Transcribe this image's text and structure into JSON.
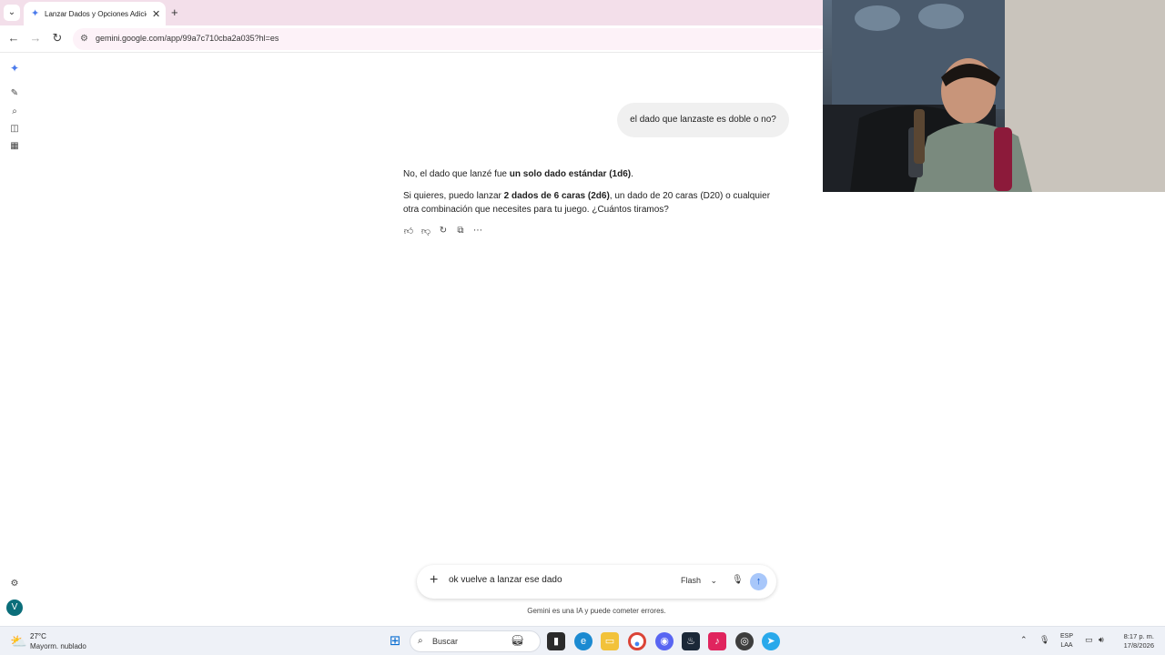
{
  "browser": {
    "tab_list_icon": "chevron-down-icon",
    "tab_title": "Lanzar Dados y Opciones Adicio",
    "tab_close": "✕",
    "new_tab": "+",
    "url": "gemini.google.com/app/99a7c710cba2a035?hl=es"
  },
  "conversation": {
    "user_message": "el dado que lanzaste es doble o no?",
    "response_p1_a": "No, el dado que lanzé fue ",
    "response_p1_b": "un solo dado estándar (1d6)",
    "response_p1_c": ".",
    "response_p2_a": "Si quieres, puedo lanzar ",
    "response_p2_b": "2 dados de 6 caras (2d6)",
    "response_p2_c": ", un dado de 20 caras (D20) o cualquier otra combinación que necesites para tu juego. ¿Cuántos tiramos?",
    "actions": [
      "thumb-up-icon",
      "thumb-down-icon",
      "regenerate-icon",
      "copy-icon",
      "more-icon"
    ]
  },
  "composer": {
    "input_value": "ok vuelve a lanzar ese dado",
    "model": "Flash",
    "disclaimer": "Gemini es una IA y puede cometer errores."
  },
  "sidebar": {
    "avatar_initial": "V",
    "icons": [
      "gemini-logo-icon",
      "new-chat-icon",
      "search-icon",
      "gems-icon",
      "apps-icon",
      "settings-icon"
    ]
  },
  "taskbar": {
    "weather_temp": "27°C",
    "weather_desc": "Mayorm. nublado",
    "search_label": "Buscar",
    "lang_1": "ESP",
    "lang_2": "LAA",
    "time": "8:17 p. m.",
    "date": "17/8/2026",
    "accent": "#0b57d0"
  }
}
